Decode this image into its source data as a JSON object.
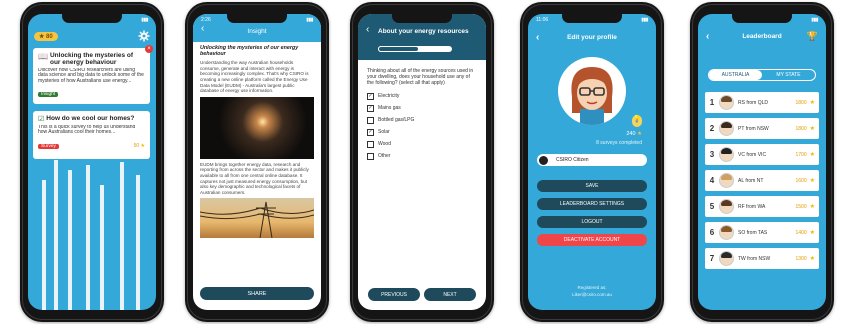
{
  "screen1": {
    "points": "80",
    "cards": [
      {
        "title": "Unlocking the mysteries of our energy behaviour",
        "text": "Discover how CSIRO researchers are using data science and big data to unlock some of the mysteries of how Australians use energy...",
        "tag": "Insight",
        "tag_color": "#2e7d32"
      },
      {
        "title": "How do we cool our homes?",
        "text": "This is a quick survey to help us understand how Australians cool their homes...",
        "tag": "Survey",
        "tag_color": "#e53935",
        "points": "50"
      }
    ]
  },
  "screen2": {
    "time": "2:26",
    "header": "Insight",
    "title": "Unlocking the mysteries of our energy behaviour",
    "para1": "Understanding the way Australian households consume, generate and interact with energy is becoming increasingly complex. That's why CSIRO is creating a new online platform called the Energy Use Data Model (EUDM) - Australia's largest public database of energy use information.",
    "para2": "EUDM brings together energy data, research and reporting from across the sector and makes it publicly available to all from one central online database. It captures not just measured energy consumption, but also key demographic and technological facets of Australian consumers.",
    "share": "SHARE"
  },
  "screen3": {
    "header": "About your energy resources",
    "progress": 0.55,
    "question": "Thinking about all of the energy sources used in your dwelling, does your household use any of the following? (select all that apply)",
    "options": [
      {
        "label": "Electricity",
        "checked": true
      },
      {
        "label": "Mains gas",
        "checked": true
      },
      {
        "label": "Bottled gas/LPG",
        "checked": false
      },
      {
        "label": "Solar",
        "checked": true
      },
      {
        "label": "Wood",
        "checked": false
      },
      {
        "label": "Other",
        "checked": false
      }
    ],
    "previous": "PREVIOUS",
    "next": "NEXT"
  },
  "screen4": {
    "time": "11:06",
    "header": "Edit your profile",
    "points": "240",
    "surveys": "8 surveys completed",
    "name": "CSIRO Citizen",
    "save": "SAVE",
    "leaderboard_settings": "LEADERBOARD SETTINGS",
    "logout": "LOGOUT",
    "deactivate": "DEACTIVATE ACCOUNT",
    "footer1": "Registered as:",
    "footer2": "Liker@csiro.com.au"
  },
  "screen5": {
    "header": "Leaderboard",
    "tab_a": "AUSTRALIA",
    "tab_b": "MY STATE",
    "rows": [
      {
        "rank": "1",
        "name": "RS from QLD",
        "points": "1800",
        "hair": "#6b4a2b"
      },
      {
        "rank": "2",
        "name": "PT from NSW",
        "points": "1800",
        "hair": "#3a2a1a"
      },
      {
        "rank": "3",
        "name": "VC from VIC",
        "points": "1700",
        "hair": "#222222"
      },
      {
        "rank": "4",
        "name": "AL from NT",
        "points": "1600",
        "hair": "#d0a060"
      },
      {
        "rank": "5",
        "name": "RF from WA",
        "points": "1500",
        "hair": "#5a3a20"
      },
      {
        "rank": "6",
        "name": "SO from TAS",
        "points": "1400",
        "hair": "#8b5a2b"
      },
      {
        "rank": "7",
        "name": "TW from NSW",
        "points": "1300",
        "hair": "#2a2a2a"
      }
    ]
  }
}
